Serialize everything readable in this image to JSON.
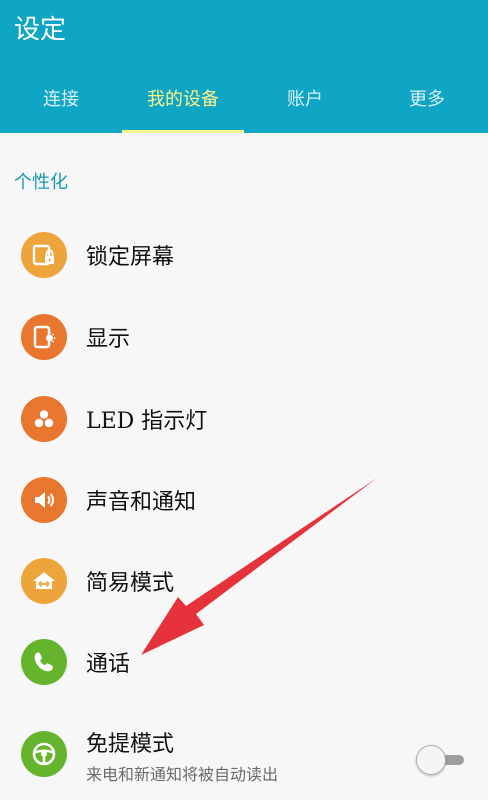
{
  "header": {
    "title": "设定",
    "tabs": [
      {
        "label": "连接",
        "active": false
      },
      {
        "label": "我的设备",
        "active": true
      },
      {
        "label": "账户",
        "active": false
      },
      {
        "label": "更多",
        "active": false
      }
    ]
  },
  "section": {
    "title": "个性化"
  },
  "items": [
    {
      "label": "锁定屏幕",
      "icon": "lock-screen-icon",
      "color": "#eda43a"
    },
    {
      "label": "显示",
      "icon": "display-icon",
      "color": "#e8762f"
    },
    {
      "label": "LED 指示灯",
      "icon": "led-icon",
      "color": "#e8762f"
    },
    {
      "label": "声音和通知",
      "icon": "sound-icon",
      "color": "#e8762f"
    },
    {
      "label": "简易模式",
      "icon": "easy-mode-icon",
      "color": "#eda43a"
    },
    {
      "label": "通话",
      "icon": "phone-icon",
      "color": "#66b32e"
    },
    {
      "label": "免提模式",
      "sublabel": "来电和新通知将被自动读出",
      "icon": "steering-wheel-icon",
      "color": "#66b32e",
      "toggle": false
    }
  ],
  "colors": {
    "appbar": "#0fa5c4",
    "active_tab": "#fbf38c",
    "arrow": "#e5323b"
  }
}
